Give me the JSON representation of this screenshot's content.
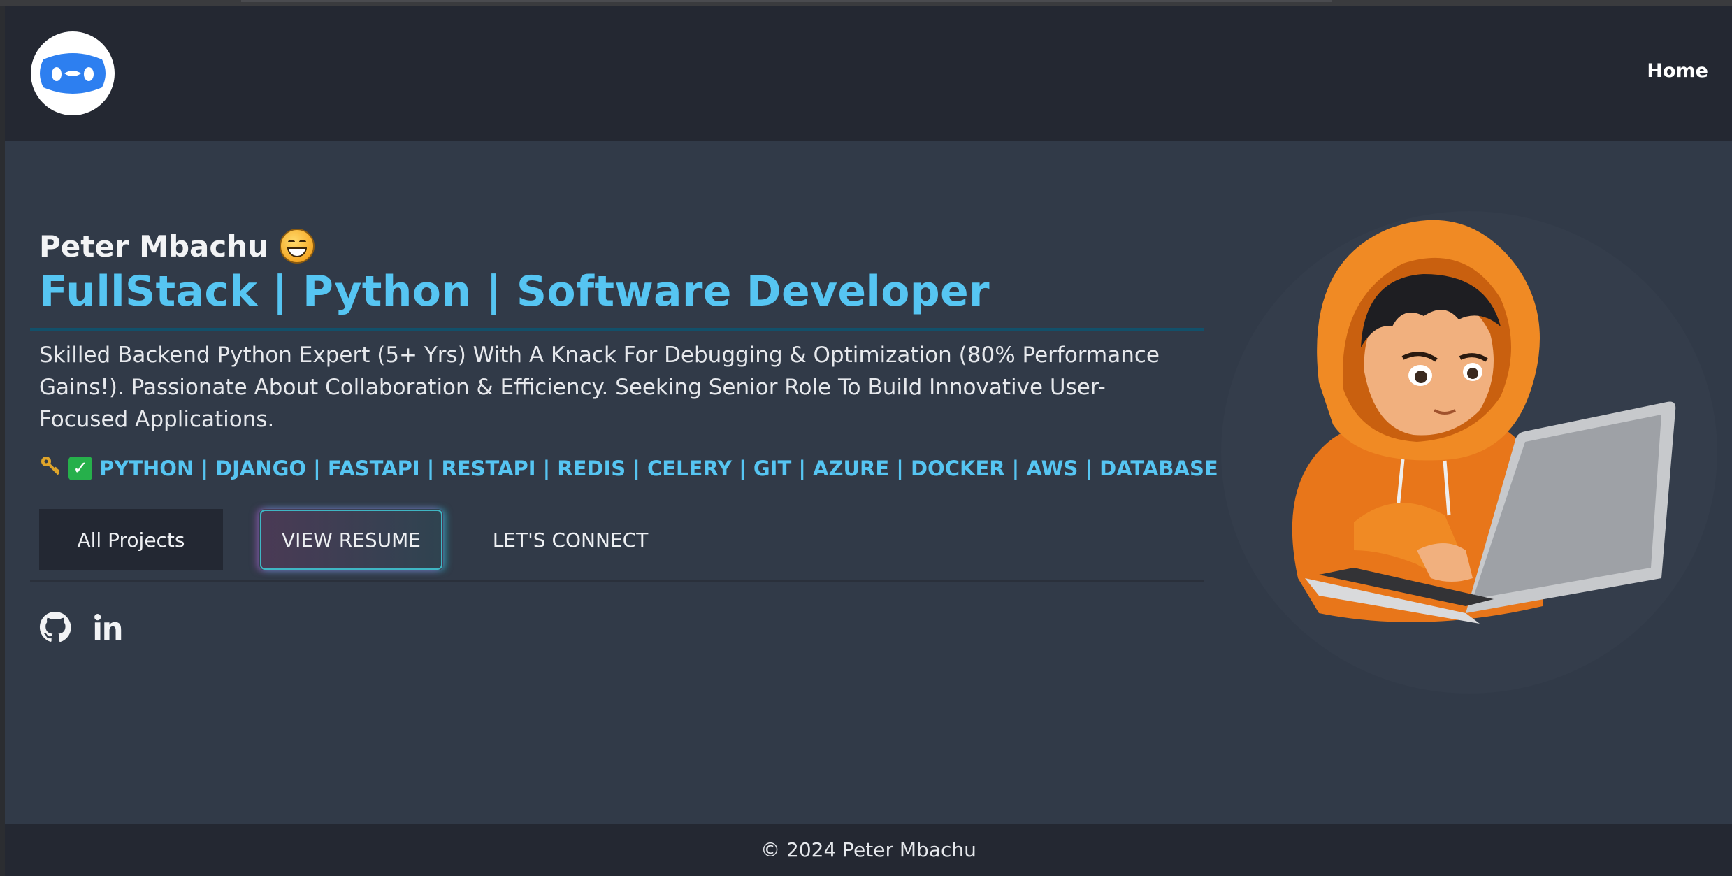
{
  "nav": {
    "home_label": "Home"
  },
  "hero": {
    "name": "Peter Mbachu",
    "headline": "FullStack | Python | Software Developer",
    "bio": "Skilled Backend Python Expert (5+ Yrs) With A Knack For Debugging & Optimization (80% Performance Gains!). Passionate About Collaboration & Efficiency. Seeking Senior Role To Build Innovative User-Focused Applications.",
    "skills": "PYTHON | DJANGO | FASTAPI | RESTAPI | REDIS | CELERY | GIT | AZURE | DOCKER | AWS | DATABASE | GO",
    "buttons": {
      "projects": "All Projects",
      "resume": "VIEW RESUME",
      "connect": "LET'S CONNECT"
    },
    "icons": [
      "grinning-face-emoji",
      "key-icon",
      "check-mark-icon",
      "github-icon",
      "linkedin-icon"
    ]
  },
  "footer": {
    "copyright": "© 2024 Peter Mbachu"
  },
  "colors": {
    "accent": "#56c5f2",
    "navbar": "#242832",
    "background": "#313a48",
    "hoodie": "#f07f1a"
  }
}
